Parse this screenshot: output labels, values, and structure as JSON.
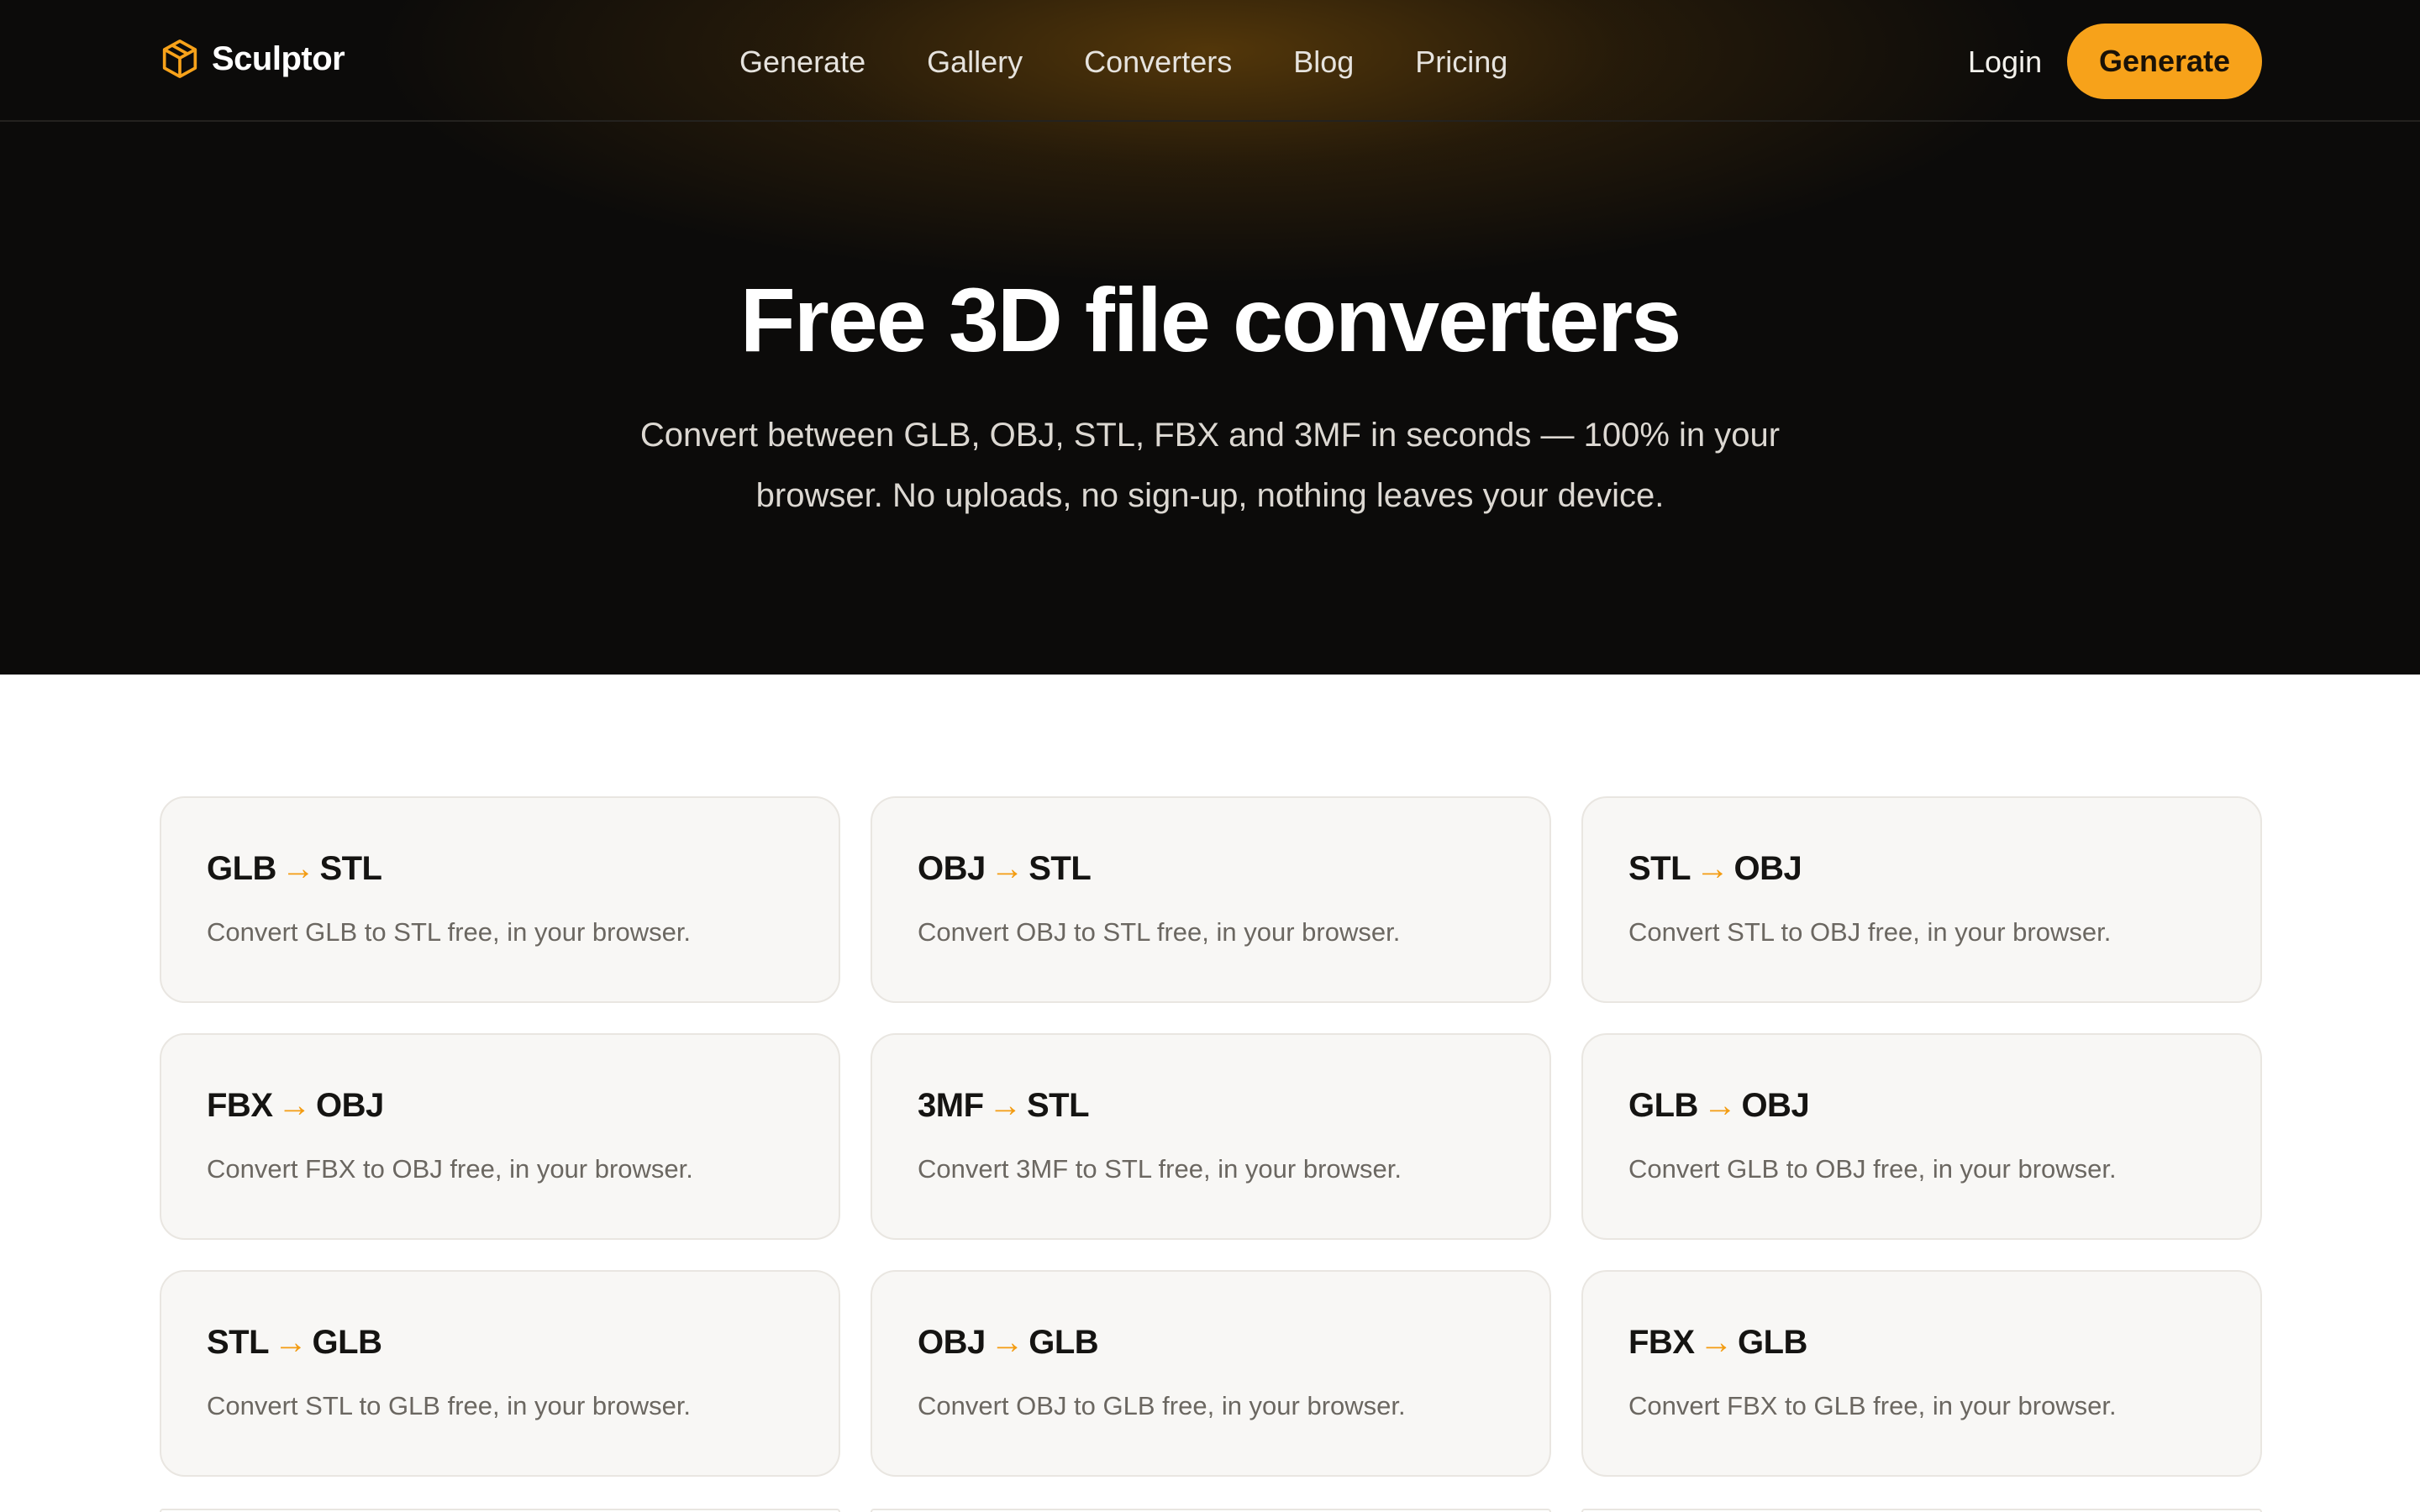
{
  "brand": {
    "name": "Sculptor",
    "icon": "cube-icon",
    "accent": "#f7a21a"
  },
  "nav": {
    "links": [
      "Generate",
      "Gallery",
      "Converters",
      "Blog",
      "Pricing"
    ],
    "login": "Login",
    "cta": "Generate"
  },
  "hero": {
    "title": "Free 3D file converters",
    "subtitle": "Convert between GLB, OBJ, STL, FBX and 3MF in seconds — 100% in your browser. No uploads, no sign-up, nothing leaves your device."
  },
  "cards": [
    {
      "from": "GLB",
      "to": "STL",
      "desc": "Convert GLB to STL free, in your browser."
    },
    {
      "from": "OBJ",
      "to": "STL",
      "desc": "Convert OBJ to STL free, in your browser."
    },
    {
      "from": "STL",
      "to": "OBJ",
      "desc": "Convert STL to OBJ free, in your browser."
    },
    {
      "from": "FBX",
      "to": "OBJ",
      "desc": "Convert FBX to OBJ free, in your browser."
    },
    {
      "from": "3MF",
      "to": "STL",
      "desc": "Convert 3MF to STL free, in your browser."
    },
    {
      "from": "GLB",
      "to": "OBJ",
      "desc": "Convert GLB to OBJ free, in your browser."
    },
    {
      "from": "STL",
      "to": "GLB",
      "desc": "Convert STL to GLB free, in your browser."
    },
    {
      "from": "OBJ",
      "to": "GLB",
      "desc": "Convert OBJ to GLB free, in your browser."
    },
    {
      "from": "FBX",
      "to": "GLB",
      "desc": "Convert FBX to GLB free, in your browser."
    }
  ],
  "arrow_glyph": "→"
}
